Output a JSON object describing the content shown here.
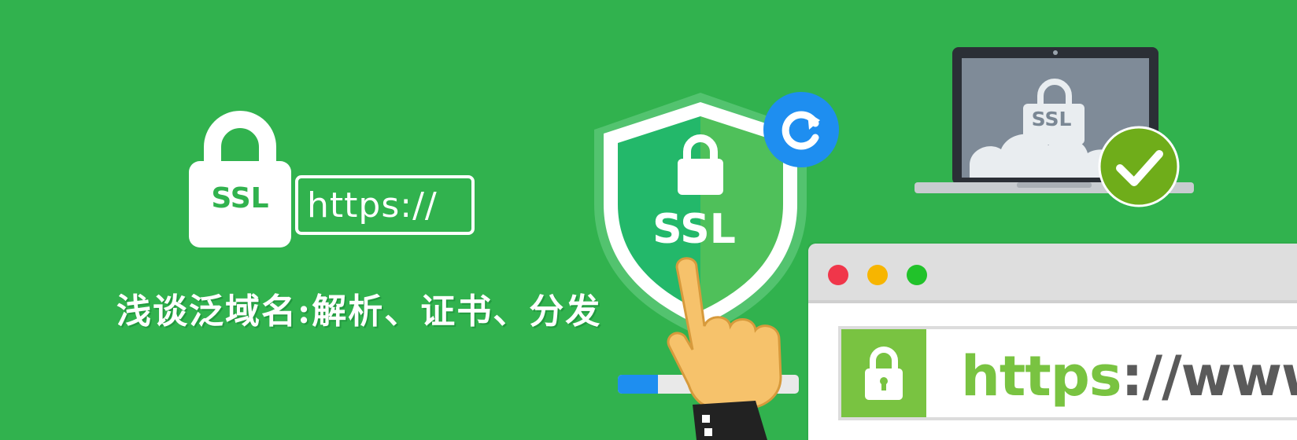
{
  "colors": {
    "background": "#31b24e",
    "accent_green": "#79c341",
    "blue": "#1e8ef0",
    "white": "#ffffff"
  },
  "logo": {
    "lock_label": "SSL",
    "url_text": "https://"
  },
  "title": "浅谈泛域名:解析、证书、分发",
  "shield": {
    "label": "SSL",
    "refresh_icon": "refresh-icon"
  },
  "progress": {
    "fraction": 0.22
  },
  "laptop": {
    "label": "SSL",
    "check_icon": "check-icon"
  },
  "browser": {
    "address_https": "https",
    "address_rest": "://www."
  }
}
